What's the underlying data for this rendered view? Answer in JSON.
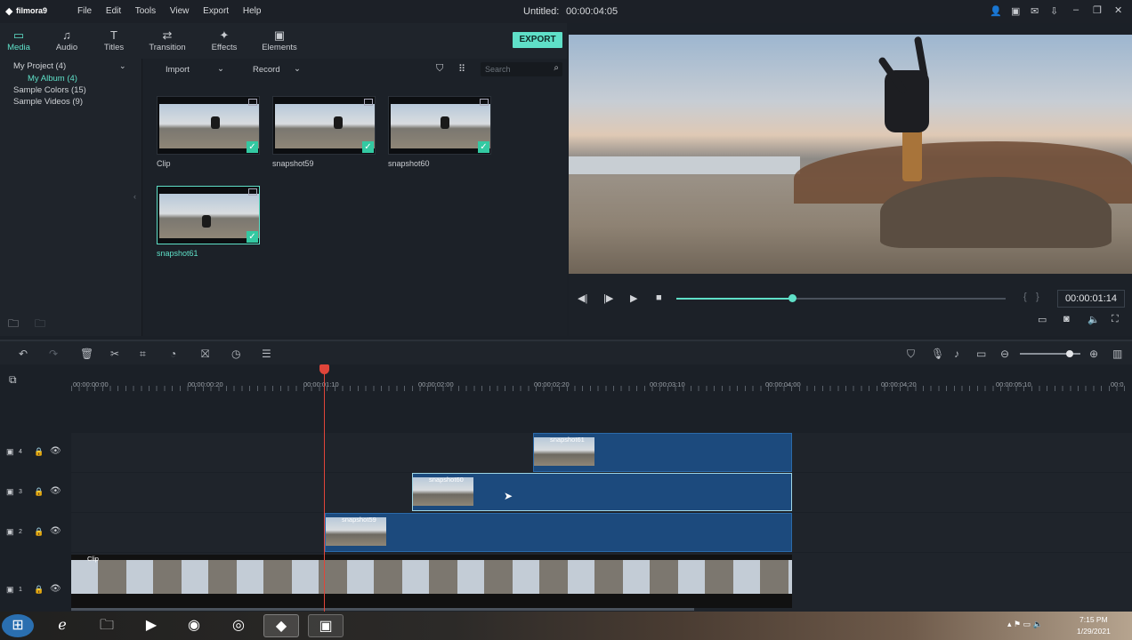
{
  "app": {
    "name": "filmora9",
    "title": "Untitled:",
    "duration": "00:00:04:05"
  },
  "menu": [
    "File",
    "Edit",
    "Tools",
    "View",
    "Export",
    "Help"
  ],
  "tabs": [
    {
      "label": "Media",
      "icon": "folder-icon"
    },
    {
      "label": "Audio",
      "icon": "music-note-icon"
    },
    {
      "label": "Titles",
      "icon": "text-icon"
    },
    {
      "label": "Transition",
      "icon": "transition-icon"
    },
    {
      "label": "Effects",
      "icon": "effects-icon"
    },
    {
      "label": "Elements",
      "icon": "image-icon"
    }
  ],
  "export_label": "EXPORT",
  "tree": {
    "project": "My Project (4)",
    "album": "My Album (4)",
    "colors": "Sample Colors (15)",
    "videos": "Sample Videos (9)"
  },
  "media_toolbar": {
    "import": "Import",
    "record": "Record",
    "search_placeholder": "Search"
  },
  "media": [
    {
      "label": "Clip"
    },
    {
      "label": "snapshot59"
    },
    {
      "label": "snapshot60"
    },
    {
      "label": "snapshot61"
    }
  ],
  "player": {
    "time": "00:00:01:14",
    "progress": 0.35
  },
  "ruler": [
    "00:00:00:00",
    "00:00:00:20",
    "00:00:01:10",
    "00:00:02:00",
    "00:00:02:20",
    "00:00:03:10",
    "00:00:04:00",
    "00:00:04:20",
    "00:00:05:10",
    "00:0"
  ],
  "tracks": [
    {
      "num": "4",
      "clip": "snapshot61"
    },
    {
      "num": "3",
      "clip": "snapshot60"
    },
    {
      "num": "2",
      "clip": "snapshot59"
    },
    {
      "num": "1",
      "clip": "Clip"
    }
  ],
  "taskbar": {
    "time": "7:15 PM",
    "date": "1/29/2021"
  },
  "colors": {
    "accent": "#5fe0c8",
    "clip": "#1c4a7d",
    "playhead": "#e0453a"
  }
}
